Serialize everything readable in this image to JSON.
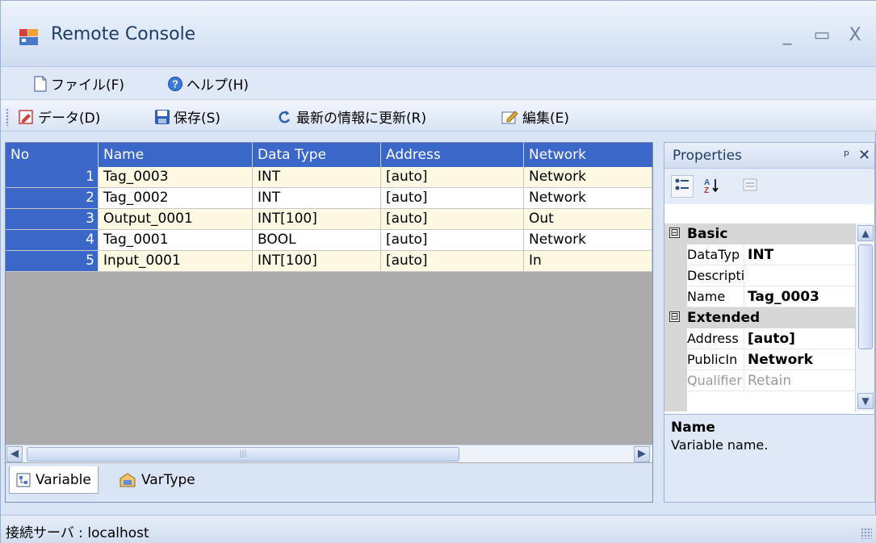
{
  "window": {
    "title": "Remote Console",
    "controls": {
      "minimize": "_",
      "maximize": "▭",
      "close": "X"
    }
  },
  "menu": [
    {
      "label": "ファイル(F)",
      "icon": "document-icon"
    },
    {
      "label": "ヘルプ(H)",
      "icon": "help-icon"
    }
  ],
  "toolbar": [
    {
      "label": "データ(D)",
      "icon": "data-icon"
    },
    {
      "label": "保存(S)",
      "icon": "save-icon"
    },
    {
      "label": "最新の情報に更新(R)",
      "icon": "refresh-icon"
    },
    {
      "label": "編集(E)",
      "icon": "edit-icon"
    }
  ],
  "grid": {
    "columns": [
      "No",
      "Name",
      "Data Type",
      "Address",
      "Network"
    ],
    "rows": [
      {
        "no": "1",
        "name": "Tag_0003",
        "type": "INT",
        "address": "[auto]",
        "network": "Network"
      },
      {
        "no": "2",
        "name": "Tag_0002",
        "type": "INT",
        "address": "[auto]",
        "network": "Network"
      },
      {
        "no": "3",
        "name": "Output_0001",
        "type": "INT[100]",
        "address": "[auto]",
        "network": "Out"
      },
      {
        "no": "4",
        "name": "Tag_0001",
        "type": "BOOL",
        "address": "[auto]",
        "network": "Network"
      },
      {
        "no": "5",
        "name": "Input_0001",
        "type": "INT[100]",
        "address": "[auto]",
        "network": "In"
      }
    ]
  },
  "tabs": [
    {
      "label": "Variable",
      "icon": "variable-icon"
    },
    {
      "label": "VarType",
      "icon": "vartype-icon"
    }
  ],
  "properties": {
    "title": "Properties",
    "pin": "ᵖ",
    "close": "✕",
    "tools": {
      "categorized": "categorized-icon",
      "alphabetical": "sort-az-icon",
      "pages": "property-pages-icon"
    },
    "categories": [
      {
        "name": "Basic",
        "toggle": "⊟",
        "items": [
          {
            "name": "DataTyp",
            "value": "INT"
          },
          {
            "name": "Descripti",
            "value": ""
          },
          {
            "name": "Name",
            "value": "Tag_0003"
          }
        ]
      },
      {
        "name": "Extended",
        "toggle": "⊟",
        "items": [
          {
            "name": "Address",
            "value": "[auto]"
          },
          {
            "name": "PublicIn",
            "value": "Network"
          },
          {
            "name": "Qualifier",
            "value": "Retain"
          }
        ]
      }
    ],
    "description": {
      "title": "Name",
      "text": "Variable name."
    }
  },
  "status": {
    "text": "接続サーバ : localhost"
  }
}
